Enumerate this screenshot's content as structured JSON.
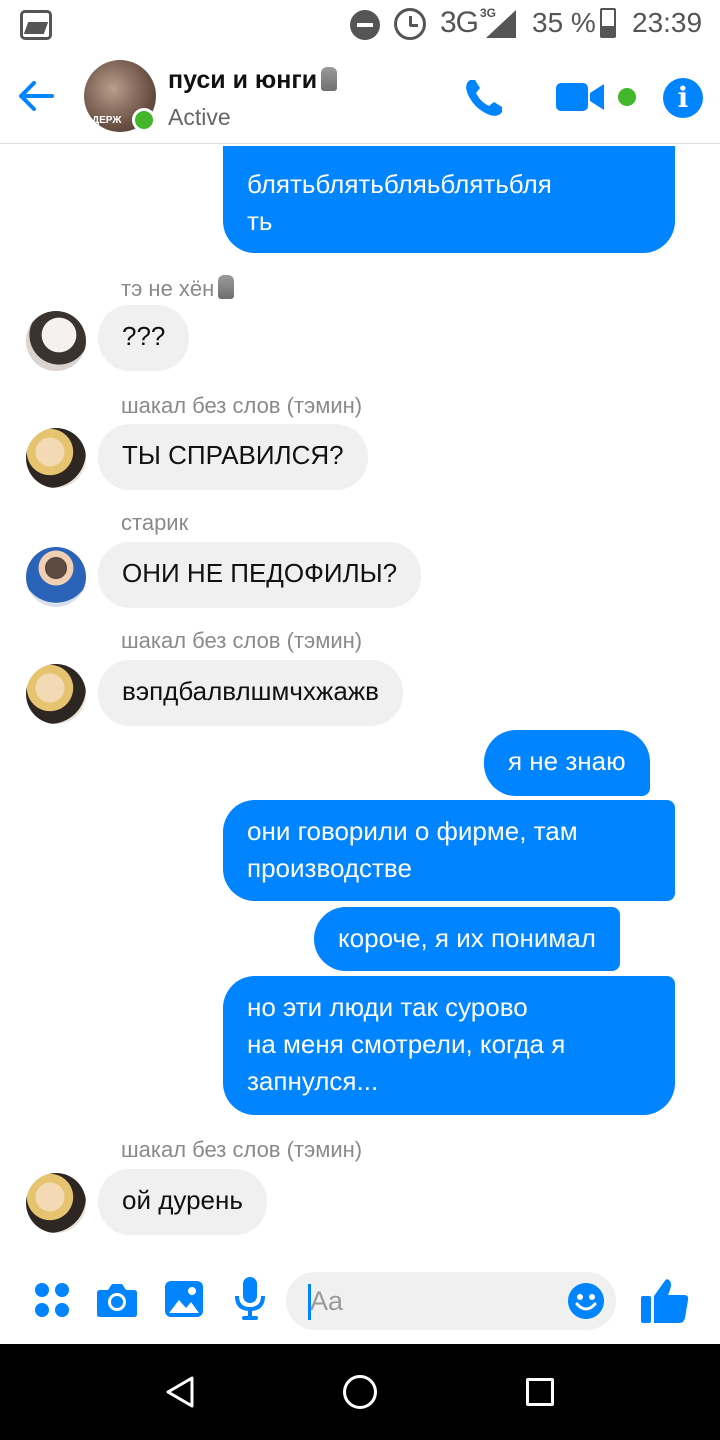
{
  "status_bar": {
    "network": "3G",
    "network_sup": "3G",
    "battery": "35 %",
    "time": "23:39",
    "icons": [
      "gallery-icon",
      "do-not-disturb-icon",
      "alarm-icon",
      "signal-icon",
      "battery-icon"
    ]
  },
  "header": {
    "title": "пуси и юнги",
    "status": "Active",
    "avatar_text": "ДЕРЖ",
    "icons": [
      "back-arrow-icon",
      "phone-icon",
      "video-camera-icon",
      "info-icon"
    ],
    "accent": "#0084ff",
    "online_color": "#42b72a"
  },
  "messages": [
    {
      "type": "out",
      "text": "блятьблятьбляьблятьбля\nть"
    },
    {
      "type": "in",
      "sender": "тэ не хён",
      "text": "???"
    },
    {
      "type": "in",
      "sender": "шакал без слов (тэмин)",
      "text": "ТЫ СПРАВИЛСЯ?"
    },
    {
      "type": "in",
      "sender": "старик",
      "text": "ОНИ НЕ ПЕДОФИЛЫ?"
    },
    {
      "type": "in",
      "sender": "шакал без слов (тэмин)",
      "text": "вэпдбалвлшмчхжажв"
    },
    {
      "type": "out",
      "text": "я не знаю"
    },
    {
      "type": "out",
      "text": "они говорили о фирме, там\nпроизводстве"
    },
    {
      "type": "out",
      "text": "короче, я их понимал"
    },
    {
      "type": "out",
      "text": "но эти люди так сурово\nна меня смотрели, когда я\nзапнулся..."
    },
    {
      "type": "in",
      "sender": "шакал без слов (тэмин)",
      "text": "ой дурень"
    }
  ],
  "composer": {
    "placeholder": "Aa",
    "icons": [
      "apps-icon",
      "camera-icon",
      "image-icon",
      "microphone-icon",
      "emoji-icon",
      "thumbs-up-icon"
    ]
  },
  "nav_bar": {
    "icons": [
      "nav-back-icon",
      "nav-home-icon",
      "nav-recents-icon"
    ]
  }
}
